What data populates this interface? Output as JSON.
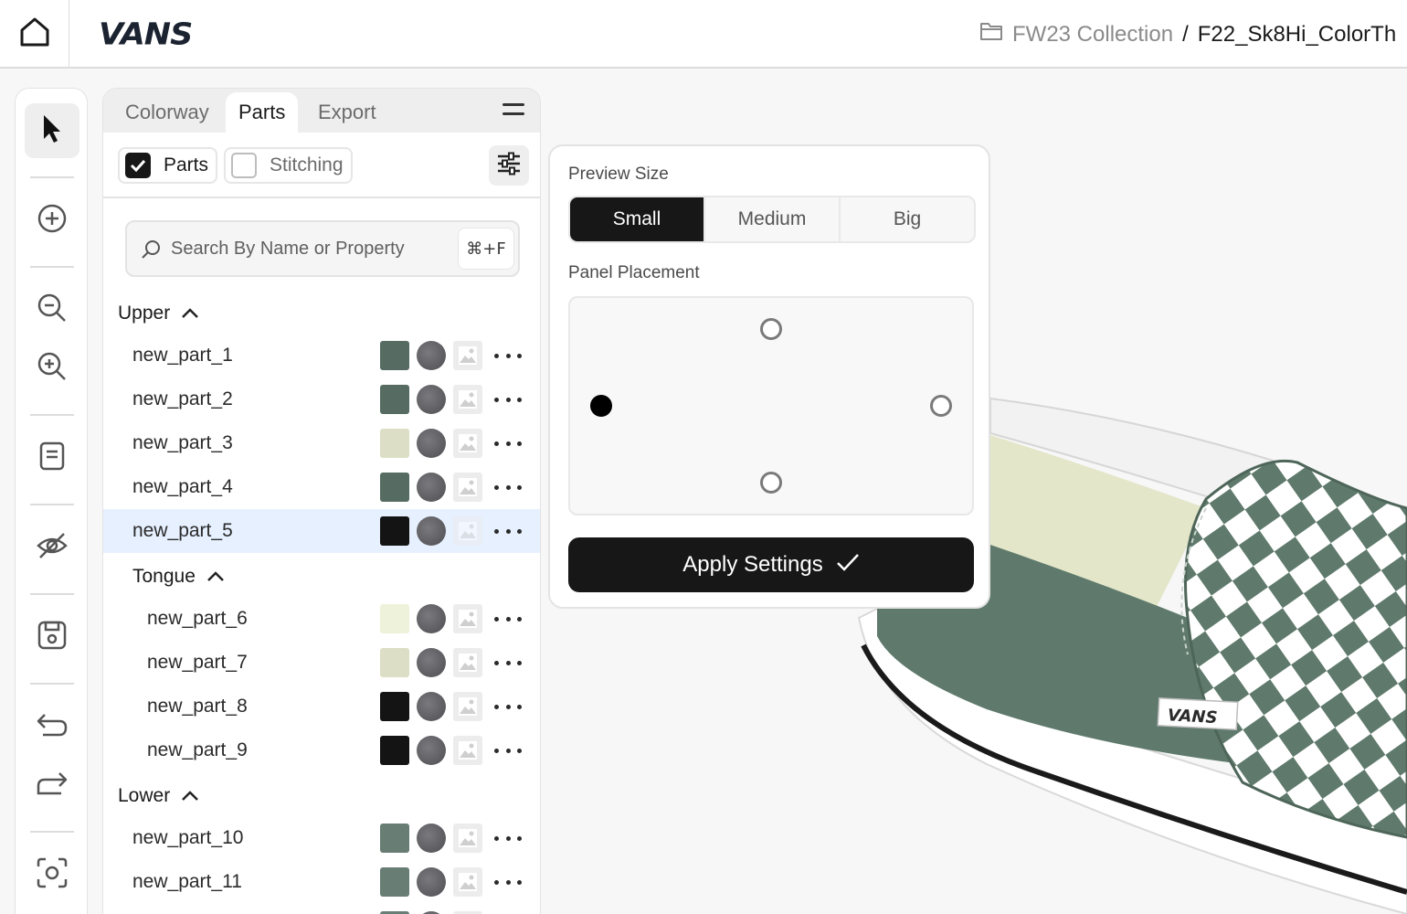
{
  "topbar": {
    "brand": "VANS",
    "breadcrumb_parent": "FW23 Collection",
    "breadcrumb_sep": "/",
    "breadcrumb_current": "F22_Sk8Hi_ColorTh"
  },
  "toolbar": {
    "tools": [
      "select-tool",
      "add-tool",
      "zoom-out-tool",
      "zoom-in-tool",
      "notes-tool",
      "hide-tool",
      "save-tool",
      "undo-tool",
      "redo-tool",
      "capture-tool"
    ]
  },
  "panel": {
    "tabs": [
      {
        "label": "Colorway"
      },
      {
        "label": "Parts"
      },
      {
        "label": "Export"
      }
    ],
    "active_tab": "Parts",
    "filters": {
      "parts_label": "Parts",
      "parts_checked": true,
      "stitching_label": "Stitching",
      "stitching_checked": false
    },
    "search": {
      "placeholder": "Search By Name or Property",
      "shortcut": "⌘+F"
    },
    "groups": {
      "upper": "Upper",
      "tongue": "Tongue",
      "lower": "Lower"
    },
    "parts": [
      {
        "name": "new_part_1",
        "color": "#566c63",
        "group": "Upper"
      },
      {
        "name": "new_part_2",
        "color": "#566c63",
        "group": "Upper"
      },
      {
        "name": "new_part_3",
        "color": "#dcdec5",
        "group": "Upper"
      },
      {
        "name": "new_part_4",
        "color": "#566c63",
        "group": "Upper"
      },
      {
        "name": "new_part_5",
        "color": "#141414",
        "group": "Upper",
        "selected": true
      },
      {
        "name": "new_part_6",
        "color": "#eef2da",
        "group": "Tongue"
      },
      {
        "name": "new_part_7",
        "color": "#dcdec5",
        "group": "Tongue"
      },
      {
        "name": "new_part_8",
        "color": "#141414",
        "group": "Tongue"
      },
      {
        "name": "new_part_9",
        "color": "#141414",
        "group": "Tongue"
      },
      {
        "name": "new_part_10",
        "color": "#687d73",
        "group": "Lower"
      },
      {
        "name": "new_part_11",
        "color": "#687d73",
        "group": "Lower"
      }
    ]
  },
  "popover": {
    "preview_size_label": "Preview Size",
    "sizes": [
      "Small",
      "Medium",
      "Big"
    ],
    "selected_size": "Small",
    "placement_label": "Panel Placement",
    "selected_placement": "left",
    "apply_label": "Apply Settings"
  },
  "colors": {
    "shoe_green": "#5f7a6c",
    "selected_row": "#e6f0ff",
    "dark": "#171717"
  }
}
